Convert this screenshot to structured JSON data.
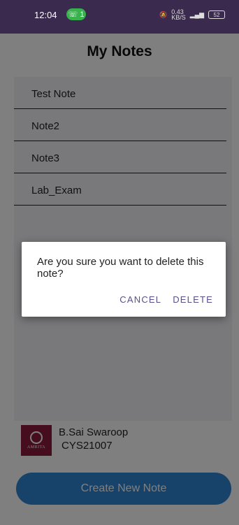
{
  "status_bar": {
    "time": "12:04",
    "notification_count": "1",
    "net_speed": "0.43\nKB/S",
    "battery": "52"
  },
  "app": {
    "title": "My Notes",
    "notes": [
      {
        "label": "Test Note"
      },
      {
        "label": "Note2"
      },
      {
        "label": "Note3"
      },
      {
        "label": "Lab_Exam"
      }
    ],
    "footer": {
      "logo_text": "AMRITA",
      "name": "B.Sai Swaroop",
      "id": "CYS21007"
    },
    "create_button": "Create New Note"
  },
  "dialog": {
    "message": "Are you sure you want to delete this note?",
    "cancel_label": "CANCEL",
    "delete_label": "DELETE"
  },
  "colors": {
    "status_bar": "#3a2a4d",
    "accent_button": "#2f86d6",
    "dialog_action": "#5a4f8c",
    "logo_bg": "#8a1b3a"
  }
}
